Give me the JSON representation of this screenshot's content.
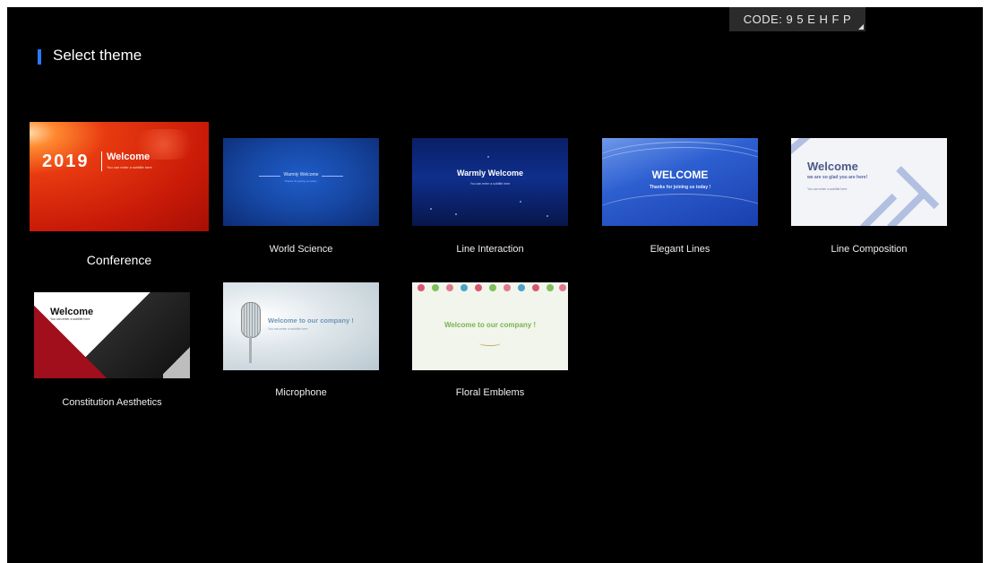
{
  "header": {
    "code_label": "CODE: 9 5 E H F P",
    "title": "Select theme"
  },
  "themes": [
    {
      "name": "Conference",
      "selected": true,
      "preview_year": "2019",
      "preview_title": "Welcome",
      "preview_subtitle": "You can enter a subtitle here"
    },
    {
      "name": "World Science",
      "preview_title": "Warmly Welcome",
      "preview_subtitle": "Thanks for joining us today !"
    },
    {
      "name": "Line Interaction",
      "preview_title": "Warmly Welcome",
      "preview_subtitle": "You can enter a subtitle here"
    },
    {
      "name": "Elegant Lines",
      "preview_title": "WELCOME",
      "preview_subtitle": "Thanks for joining us today !"
    },
    {
      "name": "Line Composition",
      "preview_title": "Welcome",
      "preview_subtitle": "we are so glad you are here!",
      "preview_note": "You can enter a subtitle here"
    },
    {
      "name": "Constitution Aesthetics",
      "preview_title": "Welcome",
      "preview_subtitle": "You can enter a subtitle here"
    },
    {
      "name": "Microphone",
      "preview_title": "Welcome to our company !",
      "preview_subtitle": "You can enter a subtitle here"
    },
    {
      "name": "Floral Emblems",
      "preview_title": "Welcome to our company !"
    }
  ],
  "colors": {
    "background": "#000000",
    "accent": "#2979ff",
    "code_box": "#2b2b2b"
  }
}
